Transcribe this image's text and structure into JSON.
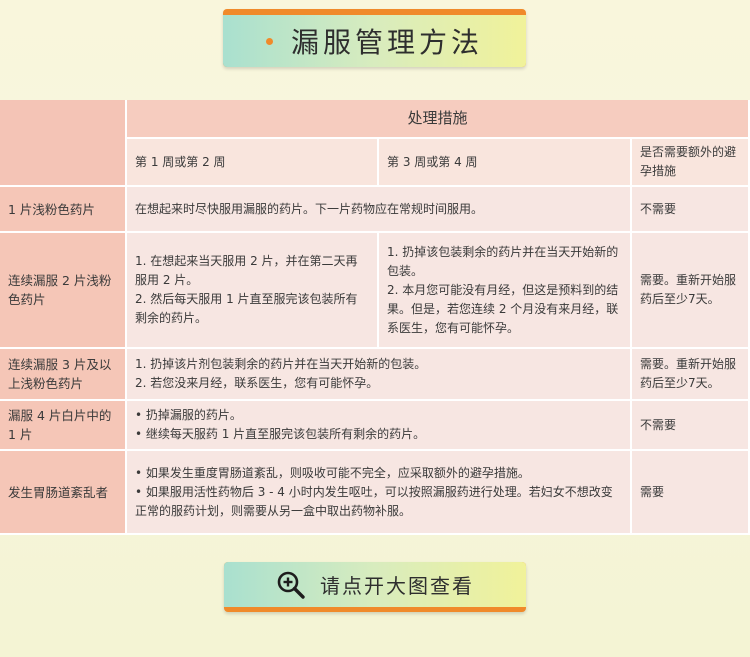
{
  "title": "漏服管理方法",
  "table": {
    "header_main": "处理措施",
    "sub_headers": [
      "第 1 周或第 2 周",
      "第 3 周或第 4 周",
      "是否需要额外的避孕措施"
    ],
    "rows": [
      {
        "label": "1 片浅粉色药片",
        "content": "在想起来时尽快服用漏服的药片。下一片药物应在常规时间服用。",
        "extra": "不需要"
      },
      {
        "label": "连续漏服 2 片浅粉色药片",
        "week12": [
          "1. 在想起来当天服用 2 片，并在第二天再服用 2 片。",
          "2. 然后每天服用 1 片直至服完该包装所有剩余的药片。"
        ],
        "week34": [
          "1. 扔掉该包装剩余的药片并在当天开始新的包装。",
          "2. 本月您可能没有月经，但这是预料到的结果。但是，若您连续 2 个月没有来月经，联系医生，您有可能怀孕。"
        ],
        "extra": "需要。重新开始服药后至少7天。"
      },
      {
        "label": "连续漏服 3 片及以上浅粉色药片",
        "content": [
          "1. 扔掉该片剂包装剩余的药片并在当天开始新的包装。",
          "2. 若您没来月经，联系医生，您有可能怀孕。"
        ],
        "extra": "需要。重新开始服药后至少7天。"
      },
      {
        "label": "漏服 4 片白片中的 1 片",
        "content": [
          "• 扔掉漏服的药片。",
          "• 继续每天服药 1 片直至服完该包装所有剩余的药片。"
        ],
        "extra": "不需要"
      },
      {
        "label": "发生胃肠道紊乱者",
        "content": [
          "• 如果发生重度胃肠道紊乱，则吸收可能不完全，应采取额外的避孕措施。",
          "• 如果服用活性药物后 3 - 4 小时内发生呕吐，可以按照漏服药进行处理。若妇女不想改变正常的服药计划，则需要从另一盒中取出药物补服。"
        ],
        "extra": "需要"
      }
    ]
  },
  "button": {
    "label": "请点开大图查看",
    "icon": "zoom-in-icon"
  }
}
